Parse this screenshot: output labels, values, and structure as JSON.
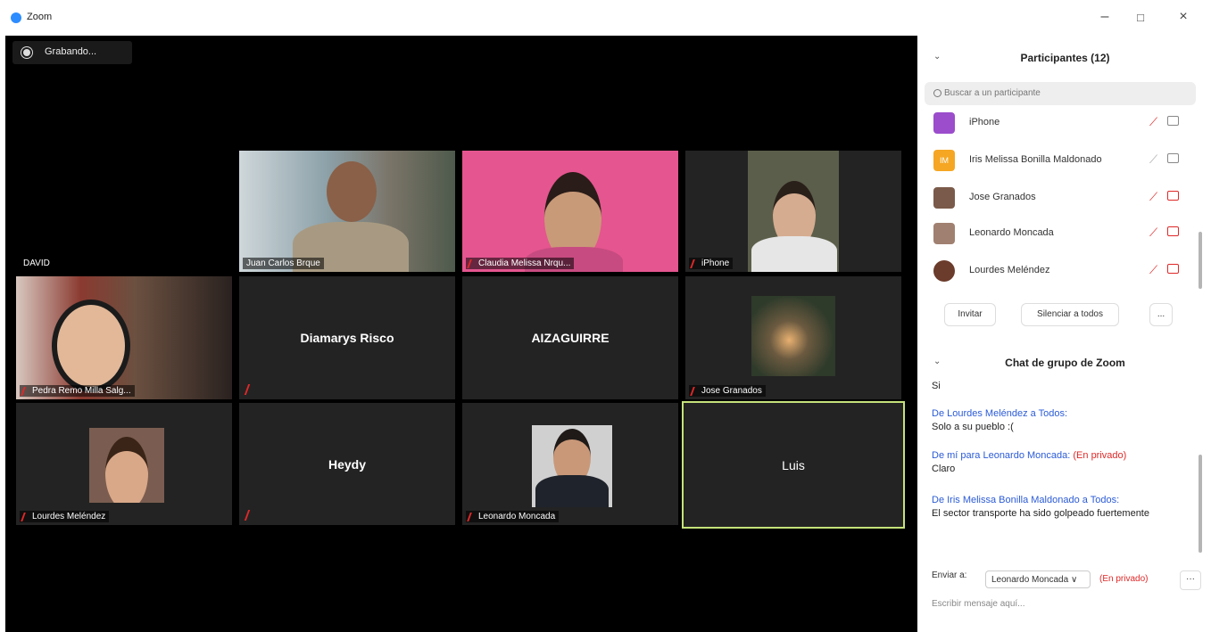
{
  "window": {
    "title": "Zoom",
    "minimize": "–",
    "maximize": "□",
    "close": "×"
  },
  "recording": {
    "label": "Grabando..."
  },
  "tiles": [
    {
      "name": "DAVID"
    },
    {
      "name": "Juan Carlos Brque"
    },
    {
      "name": "Claudia Melissa Nrqu..."
    },
    {
      "name": "iPhone"
    },
    {
      "name": "Pedra Remo Milla Salg..."
    },
    {
      "name": "Diamarys Risco"
    },
    {
      "name": "AIZAGUIRRE"
    },
    {
      "name": "Jose Granados"
    },
    {
      "name": "Lourdes Meléndez"
    },
    {
      "name": "Heydy"
    },
    {
      "name": "Leonardo Moncada"
    },
    {
      "name": "Luis"
    }
  ],
  "participants": {
    "title": "Participantes (12)",
    "search_placeholder": "Buscar a un participante",
    "items": [
      {
        "name": "iPhone",
        "avatar": "",
        "color": "#9b4dcc"
      },
      {
        "name": "Iris Melissa Bonilla Maldonado",
        "avatar": "IM",
        "color": "#f5a623"
      },
      {
        "name": "Jose Granados",
        "avatar": "",
        "color": "#7a5a4a"
      },
      {
        "name": "Leonardo Moncada",
        "avatar": "",
        "color": "#a08070"
      },
      {
        "name": "Lourdes Meléndez",
        "avatar": "",
        "color": "#6b3b2b"
      }
    ],
    "invite": "Invitar",
    "mute_all": "Silenciar a todos",
    "more": "..."
  },
  "chat": {
    "title": "Chat de grupo de Zoom",
    "messages": [
      {
        "from": "",
        "text": "Si",
        "private": ""
      },
      {
        "from": "De Lourdes Meléndez a Todos:",
        "text": "Solo a su pueblo :(",
        "private": ""
      },
      {
        "from": "De mí para Leonardo Moncada:",
        "text": "Claro",
        "private": "(En privado)"
      },
      {
        "from": "De Iris Melissa Bonilla Maldonado a Todos:",
        "text": "El sector transporte ha sido golpeado fuertemente",
        "private": ""
      }
    ],
    "to_label": "Enviar a:",
    "to_value": "Leonardo Moncada ∨",
    "to_private": "(En privado)",
    "more": "···",
    "input_placeholder": "Escribir mensaje aquí..."
  }
}
